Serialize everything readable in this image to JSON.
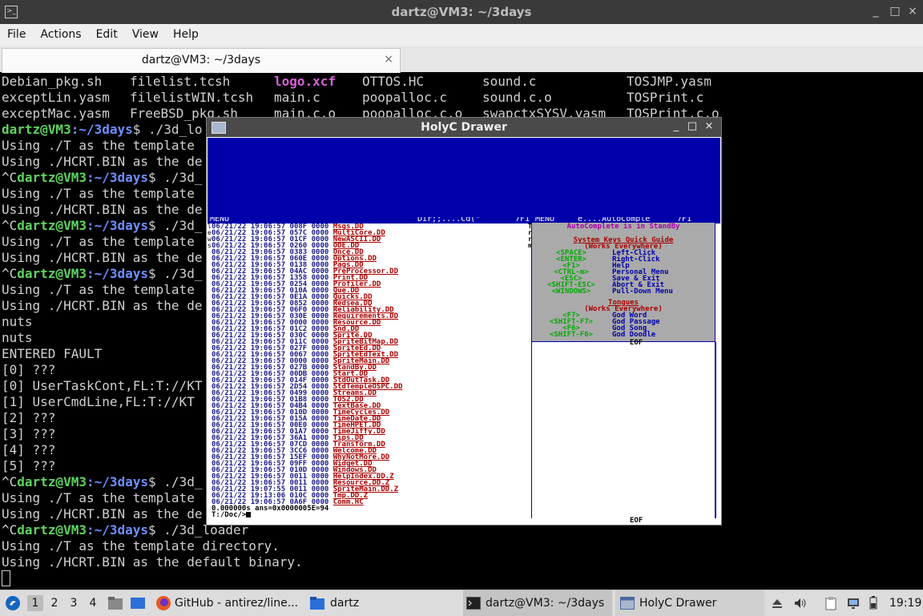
{
  "window": {
    "title": "dartz@VM3: ~/3days",
    "menu": [
      "File",
      "Actions",
      "Edit",
      "View",
      "Help"
    ],
    "tab_label": "dartz@VM3: ~/3days",
    "tab_close": "×",
    "min": "_",
    "max": "□",
    "close": "×"
  },
  "terminal": {
    "files": {
      "col1": [
        "Debian_pkg.sh",
        "exceptLin.yasm",
        "exceptMac.yasm"
      ],
      "col2": [
        "filelist.tcsh",
        "filelistWIN.tcsh",
        "FreeBSD_pkg.sh"
      ],
      "col3": [
        "logo.xcf",
        "main.c",
        "main.c.o"
      ],
      "col4": [
        "OTTOS.HC",
        "poopalloc.c",
        "poopalloc.c.o"
      ],
      "col5": [
        "sound.c",
        "sound.c.o",
        "swapctxSYSV.yasm"
      ],
      "col6": [
        "TOSJMP.yasm",
        "TOSPrint.c",
        "TOSPrint.c.o"
      ]
    },
    "prompt_user": "dartz@VM3",
    "prompt_path": ":~/3days",
    "prompt_suffix": "$ ",
    "partial_cmd": "./3d_lo",
    "partial_cmd2": "./3d_",
    "full_cmd": "./3d_loader",
    "using_t_partial": "Using ./T as the template",
    "using_bin_partial": "Using ./HCRT.BIN as the de",
    "using_t": "Using ./T as the template directory.",
    "using_bin": "Using ./HCRT.BIN as the default binary.",
    "ctrl_c": "^C",
    "nuts": "nuts",
    "fault": "ENTERED FAULT",
    "fault_lines": [
      "[0] ???",
      "[0] UserTaskCont,FL:T://KT",
      "[1] UserCmdLine,FL:T://KT",
      "[2] ???",
      "[3] ???",
      "[4] ???",
      "[5] ???"
    ]
  },
  "holyc": {
    "title": "HolyC Drawer",
    "topbar_left": "MENU",
    "topbar_dir": "Dir;;....Cd(\"",
    "topbar_mid": "7F1",
    "topbar_menu2": "MENU",
    "topbar_ac": "e....AutoComple",
    "topbar_right": "7F1",
    "left_marks": "l\ne\nw\ns",
    "mid_marks": "T\nr\nr\nm",
    "listing": [
      [
        "06/21/22 19:06:57 008F 0000 ",
        "Msgs.DD"
      ],
      [
        "06/21/22 19:06:57 057C 0000 ",
        "MultiCore.DD"
      ],
      [
        "06/21/22 19:06:57 01CF 0000 ",
        "NewASCII.DD"
      ],
      [
        "06/21/22 19:06:57 0260 0000 ",
        "ODE.DD"
      ],
      [
        "06/21/22 19:06:57 0383 0000 ",
        "Once.DD"
      ],
      [
        "06/21/22 19:06:57 060E 0000 ",
        "Options.DD"
      ],
      [
        "06/21/22 19:06:57 0138 0000 ",
        "Pags.DD"
      ],
      [
        "06/21/22 19:06:57 04AC 0000 ",
        "PreProcessor.DD"
      ],
      [
        "06/21/22 19:06:57 1358 0000 ",
        "Print.DD"
      ],
      [
        "06/21/22 19:06:57 0254 0000 ",
        "Profiler.DD"
      ],
      [
        "06/21/22 19:06:57 010A 0000 ",
        "Que.DD"
      ],
      [
        "06/21/22 19:06:57 0E1A 0000 ",
        "Quicks.DD"
      ],
      [
        "06/21/22 19:06:57 0852 0000 ",
        "Redsea.DD"
      ],
      [
        "06/21/22 19:06:57 06F0 0000 ",
        "Reliability.DD"
      ],
      [
        "06/21/22 19:06:57 030E 0000 ",
        "Requirements.DD"
      ],
      [
        "06/21/22 19:06:57 0000 0000 ",
        "Resource.DD"
      ],
      [
        "06/21/22 19:06:57 01C2 0000 ",
        "Snd.DD"
      ],
      [
        "06/21/22 19:06:57 030C 0000 ",
        "Sprite.DD"
      ],
      [
        "06/21/22 19:06:57 011C 0000 ",
        "SpriteBitMap.DD"
      ],
      [
        "06/21/22 19:06:57 027F 0000 ",
        "SpriteEd.DD"
      ],
      [
        "06/21/22 19:06:57 0067 0000 ",
        "SpriteEdText.DD"
      ],
      [
        "06/21/22 19:06:57 0000 0000 ",
        "SpriteMain.DD"
      ],
      [
        "06/21/22 19:06:57 027B 0000 ",
        "StandBy.DD"
      ],
      [
        "06/21/22 19:06:57 00DB 0000 ",
        "Start.DD"
      ],
      [
        "06/21/22 19:06:57 014F 0000 ",
        "StdOutTask.DD"
      ],
      [
        "06/21/22 19:06:57 2D54 0000 ",
        "StdTempleOSPC.DD"
      ],
      [
        "06/21/22 19:06:57 0499 0000 ",
        "Streams.DD"
      ],
      [
        "06/21/22 19:06:57 01B8 0000 ",
        "TOS2.DD"
      ],
      [
        "06/21/22 19:06:57 04B4 0000 ",
        "TextBase.DD"
      ],
      [
        "06/21/22 19:06:57 010D 0000 ",
        "TimeCycles.DD"
      ],
      [
        "06/21/22 19:06:57 015A 0000 ",
        "TimeDate.DD"
      ],
      [
        "06/21/22 19:06:57 00E0 0000 ",
        "TimeHPET.DD"
      ],
      [
        "06/21/22 19:06:57 01A7 0000 ",
        "TimeJiffy.DD"
      ],
      [
        "06/21/22 19:06:57 36A1 0000 ",
        "Tips.DD"
      ],
      [
        "06/21/22 19:06:57 07CD 0000 ",
        "Transform.DD"
      ],
      [
        "06/21/22 19:06:57 3CC6 0000 ",
        "Welcome.DD"
      ],
      [
        "06/21/22 19:06:57 15EF 0000 ",
        "WhyNotMore.DD"
      ],
      [
        "06/21/22 19:06:57 09FF 0000 ",
        "Widget.DD"
      ],
      [
        "06/21/22 19:06:57 010D 0000 ",
        "Windows.DD"
      ],
      [
        "06/21/22 19:06:57 0011 0000 ",
        "HelpIndex.DD.Z"
      ],
      [
        "06/21/22 19:06:57 0011 0000 ",
        "Resource.DD.Z"
      ],
      [
        "06/21/22 19:07:55 0011 0000 ",
        "SpriteMain.DD.Z"
      ],
      [
        "06/21/22 19:13:06 010C 0000 ",
        "Tmp.DD.Z"
      ],
      [
        "06/21/22 19:06:57 0A6F 0000 ",
        "Comm.HC"
      ]
    ],
    "result_line": "0.000000s ans=0x0000005E=94",
    "prompt": "T:/Doc/>",
    "help": {
      "standby": "AutoComplete is in StandBy",
      "heading": "System Keys Quick Guide",
      "works": "(Works Everywhere)",
      "keys": [
        [
          "<SPACE>",
          "Left-Click"
        ],
        [
          "<ENTER>",
          "Right-Click"
        ],
        [
          "<F1>",
          "Help"
        ],
        [
          "<CTRL-m>",
          "Personal Menu"
        ],
        [
          "<ESC>",
          "Save & Exit"
        ],
        [
          "<SHIFT-ESC>",
          "Abort & Exit"
        ],
        [
          "<WINDOWS>",
          "Pull-Down Menu"
        ]
      ],
      "tongues": "Tongues",
      "works2": "(Works Everywhere)",
      "tkeys": [
        [
          "<F7>",
          "God Word"
        ],
        [
          "<SHIFT-F7>",
          "God Passage"
        ],
        [
          "<F6>",
          "God Song"
        ],
        [
          "<SHIFT-F6>",
          "God Doodle"
        ]
      ]
    },
    "eof": "EOF"
  },
  "taskbar": {
    "workspaces": [
      "1",
      "2",
      "3",
      "4"
    ],
    "github": "GitHub - antirez/line...",
    "dartz": "dartz",
    "term_task": "dartz@VM3: ~/3days",
    "holyc_task": "HolyC Drawer",
    "clock": "19:19"
  }
}
